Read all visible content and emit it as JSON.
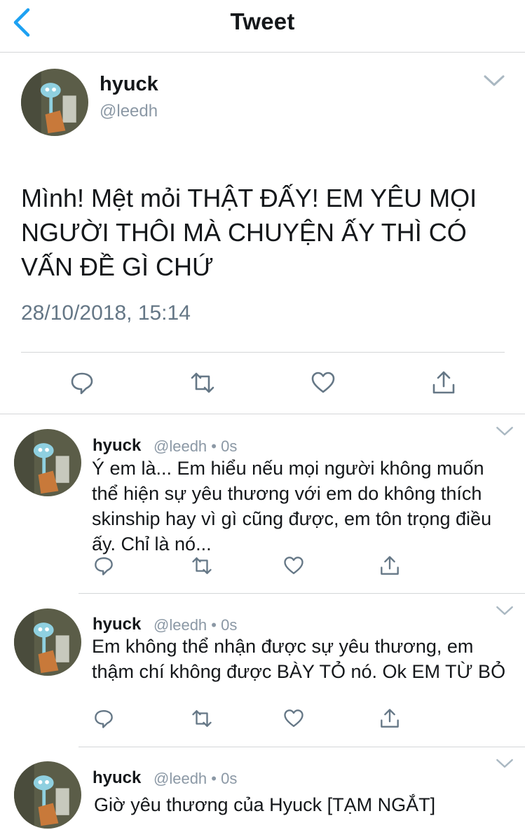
{
  "header": {
    "title": "Tweet",
    "back_icon": "chevron-left-icon"
  },
  "colors": {
    "accent": "#1da1f2",
    "icon_gray": "#657786",
    "divider": "#d4d6d8"
  },
  "main_tweet": {
    "name": "hyuck",
    "handle": "@leedh",
    "text": "Mình! Mệt mỏi THẬT ĐẤY! EM YÊU MỌI NGƯỜI THÔI MÀ CHUYỆN ẤY THÌ CÓ VẤN ĐỀ GÌ CHỨ",
    "timestamp": "28/10/2018, 15:14",
    "actions": [
      "reply-icon",
      "retweet-icon",
      "like-icon",
      "share-icon"
    ]
  },
  "replies": [
    {
      "name": "hyuck",
      "meta": "@leedh • 0s",
      "text": "Ý em là... Em hiểu nếu mọi người không muốn thể hiện sự yêu thương với em do không thích skinship hay vì gì cũng được, em tôn trọng điều ấy. Chỉ là nó..."
    },
    {
      "name": "hyuck",
      "meta": "@leedh • 0s",
      "text": "Em không thể nhận được sự yêu thương, em thậm chí không được BÀY TỎ nó. Ok EM TỪ BỎ"
    },
    {
      "name": "hyuck",
      "meta": "@leedh • 0s",
      "text": "Giờ yêu thương của Hyuck [TẠM NGẮT]"
    }
  ]
}
